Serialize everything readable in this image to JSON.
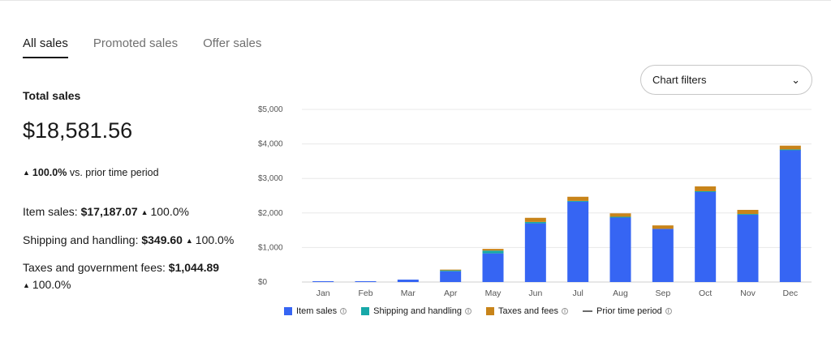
{
  "tabs": [
    {
      "label": "All sales",
      "active": true
    },
    {
      "label": "Promoted sales",
      "active": false
    },
    {
      "label": "Offer sales",
      "active": false
    }
  ],
  "summary": {
    "total_label": "Total sales",
    "total_value": "$18,581.56",
    "change_pct": "100.0%",
    "change_text": "vs. prior time period",
    "item_sales_label": "Item sales:",
    "item_sales_value": "$17,187.07",
    "item_sales_change": "100.0%",
    "shipping_label": "Shipping and handling:",
    "shipping_value": "$349.60",
    "shipping_change": "100.0%",
    "taxes_label": "Taxes and government fees:",
    "taxes_value": "$1,044.89",
    "taxes_change": "100.0%"
  },
  "filters": {
    "label": "Chart filters"
  },
  "legend": {
    "item_sales": "Item sales",
    "shipping": "Shipping and handling",
    "taxes": "Taxes and fees",
    "prior": "Prior time period"
  },
  "colors": {
    "item_sales": "#3665f3",
    "shipping": "#17a8a8",
    "taxes": "#c8841a",
    "prior": "#6b6b6b"
  },
  "chart_data": {
    "type": "bar",
    "stacked": true,
    "categories": [
      "Jan",
      "Feb",
      "Mar",
      "Apr",
      "May",
      "Jun",
      "Jul",
      "Aug",
      "Sep",
      "Oct",
      "Nov",
      "Dec"
    ],
    "series": [
      {
        "name": "Item sales",
        "values": [
          0,
          0,
          70,
          310,
          830,
          1700,
          2330,
          1880,
          1540,
          2620,
          1960,
          3830
        ]
      },
      {
        "name": "Shipping and handling",
        "values": [
          0,
          0,
          0,
          40,
          80,
          40,
          20,
          10,
          0,
          10,
          10,
          10
        ]
      },
      {
        "name": "Taxes and fees",
        "values": [
          0,
          0,
          0,
          10,
          50,
          120,
          120,
          100,
          100,
          140,
          120,
          110
        ]
      }
    ],
    "ylim": [
      0,
      5000
    ],
    "yticks": [
      "$0",
      "$1,000",
      "$2,000",
      "$3,000",
      "$4,000",
      "$5,000"
    ],
    "grid": true,
    "legend_position": "bottom"
  }
}
